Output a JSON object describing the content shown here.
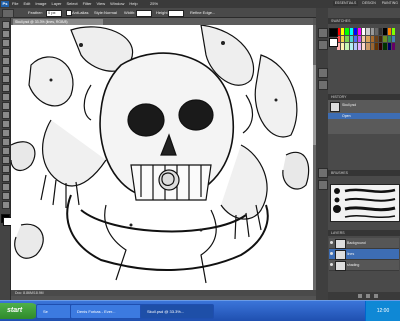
{
  "app": {
    "logo": "Ps",
    "menu": [
      "File",
      "Edit",
      "Image",
      "Layer",
      "Select",
      "Filter",
      "View",
      "Window",
      "Help"
    ],
    "zoom": "25%",
    "workspace": {
      "essentials": "ESSENTIALS",
      "design": "DESIGN",
      "painting": "PAINTING"
    }
  },
  "options": {
    "feather_label": "Feather:",
    "feather_value": "0 px",
    "antialias_label": "Anti-alias",
    "style_label": "Style:",
    "style_value": "Normal",
    "width_label": "Width:",
    "height_label": "Height:",
    "refine_label": "Refine Edge..."
  },
  "document": {
    "tab_title": "Skull.psd @ 33.3% (lines, RGB/8)",
    "status": "Doc: 8.86M/18.9M"
  },
  "panels": {
    "swatches_title": "SWATCHES",
    "history_title": "HISTORY",
    "history_items": [
      "Skull.psd",
      "Open"
    ],
    "brushes_title": "BRUSHES",
    "layers_title": "LAYERS",
    "layers": [
      {
        "name": "Background",
        "selected": false
      },
      {
        "name": "lines",
        "selected": true
      },
      {
        "name": "shading",
        "selected": false
      }
    ]
  },
  "taskbar": {
    "start": "start",
    "tasks": [
      {
        "label": "Se"
      },
      {
        "label": "Denis Forkas - Ever..."
      },
      {
        "label": "Skull.psd @ 33.3%...",
        "active": true
      }
    ],
    "tray_time": "12:00"
  },
  "colors": {
    "accent": "#3d6db4",
    "taskbar": "#245edb",
    "start": "#3a9a35"
  }
}
